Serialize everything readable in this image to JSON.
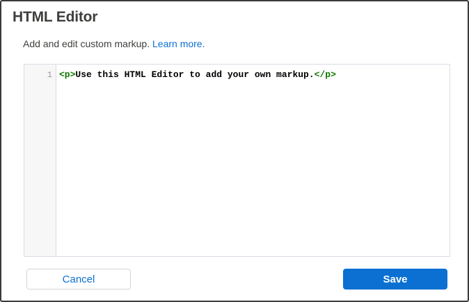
{
  "dialog": {
    "title": "HTML Editor",
    "description": "Add and edit custom markup.",
    "learn_more_label": "Learn more."
  },
  "editor": {
    "lines": [
      {
        "number": "1",
        "open_tag": "<p>",
        "text": "Use this HTML Editor to add your own markup.",
        "close_tag": "</p>"
      }
    ]
  },
  "buttons": {
    "cancel_label": "Cancel",
    "save_label": "Save"
  },
  "colors": {
    "accent": "#0b70d1",
    "tag": "#117700",
    "border": "#3a3a3a"
  }
}
